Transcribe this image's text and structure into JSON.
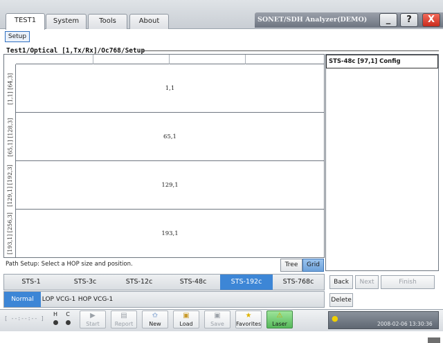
{
  "tabs": [
    {
      "label": "TEST1",
      "active": true
    },
    {
      "label": "System",
      "active": false
    },
    {
      "label": "Tools",
      "active": false
    },
    {
      "label": "About",
      "active": false
    }
  ],
  "window": {
    "title": "SONET/SDH Analyzer(DEMO)",
    "min_label": "_",
    "help_label": "?",
    "close_label": "X"
  },
  "setup_button": "Setup",
  "breadcrumb": "Test1/Optical [1,Tx/Rx]/Oc768/Setup",
  "grid": {
    "rows": [
      {
        "side_label": "[1,1] [64,3]",
        "cell": "1,1"
      },
      {
        "side_label": "[65,1] [128,3]",
        "cell": "65,1"
      },
      {
        "side_label": "[129,1] [192,3]",
        "cell": "129,1"
      },
      {
        "side_label": "[193,1] [256,3]",
        "cell": "193,1"
      }
    ]
  },
  "config_panel": {
    "title": "STS-48c  [97,1] Config"
  },
  "status_text": "Path Setup: Select a HOP size and position.",
  "view_buttons": {
    "tree": "Tree",
    "grid": "Grid",
    "selected": "Grid"
  },
  "sizes": {
    "options": [
      "STS-1",
      "STS-3c",
      "STS-12c",
      "STS-48c",
      "STS-192c",
      "STS-768c"
    ],
    "selected": "STS-192c"
  },
  "modes": {
    "options": [
      "Normal",
      "LOP VCG-1",
      "HOP VCG-1"
    ],
    "selected": "Normal"
  },
  "nav": {
    "back": "Back",
    "next": "Next",
    "finish": "Finish",
    "delete": "Delete"
  },
  "toolbar": {
    "time_placeholder": "[ --:--:-- ]",
    "indicators": [
      {
        "label": "H"
      },
      {
        "label": "C"
      }
    ],
    "buttons": [
      {
        "label": "Start",
        "icon": "play-icon",
        "enabled": false
      },
      {
        "label": "Report",
        "icon": "report-icon",
        "enabled": false
      },
      {
        "label": "New",
        "icon": "new-file-icon",
        "enabled": true
      },
      {
        "label": "Load",
        "icon": "folder-open-icon",
        "enabled": true
      },
      {
        "label": "Save",
        "icon": "save-icon",
        "enabled": false
      },
      {
        "label": "Favorites",
        "icon": "star-icon",
        "enabled": true
      },
      {
        "label": "Laser",
        "icon": "laser-warning-icon",
        "enabled": true
      }
    ]
  },
  "datetime": "2008-02-06 13:30:36",
  "colors": {
    "selected_blue": "#3d86d6",
    "laser_green": "#55b85a",
    "close_red": "#c92c1d"
  }
}
